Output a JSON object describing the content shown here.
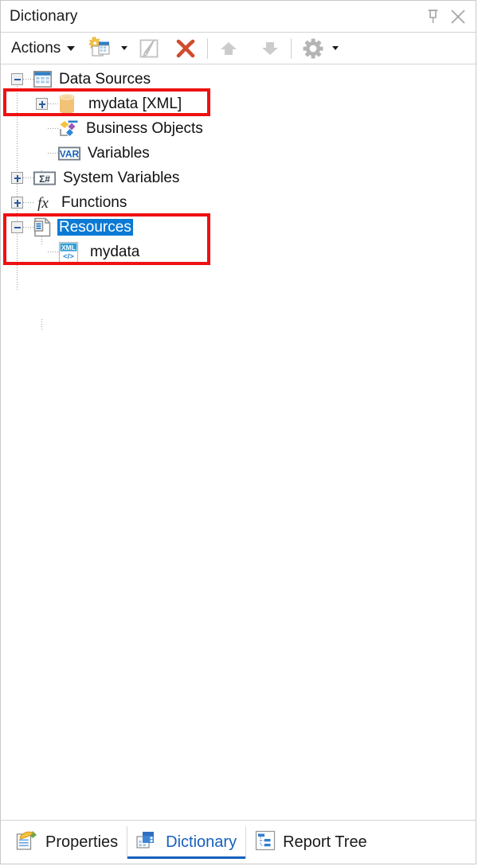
{
  "window": {
    "title": "Dictionary",
    "pin_icon": "pin-icon",
    "close_icon": "close-icon"
  },
  "toolbar": {
    "actions_label": "Actions",
    "actions_caret": "chevron-down-icon",
    "new_item_icon": "new-data-source-icon",
    "new_item_caret": "chevron-down-icon",
    "edit_icon": "edit-pencil-icon",
    "delete_icon": "delete-x-icon",
    "move_up_icon": "arrow-up-icon",
    "move_down_icon": "arrow-down-icon",
    "settings_icon": "gear-icon",
    "settings_caret": "chevron-down-icon"
  },
  "tree": {
    "nodes": [
      {
        "label": "Data Sources",
        "icon": "table-grid-icon",
        "toggle": "minus",
        "level": 0,
        "selected": false
      },
      {
        "label": "mydata [XML]",
        "icon": "database-cylinder-icon",
        "toggle": "plus",
        "level": 1,
        "selected": false
      },
      {
        "label": "Business Objects",
        "icon": "business-objects-icon",
        "toggle": "none",
        "level": 0,
        "selected": false
      },
      {
        "label": "Variables",
        "icon": "var-icon",
        "toggle": "none",
        "level": 0,
        "selected": false
      },
      {
        "label": "System Variables",
        "icon": "sigma-hash-icon",
        "toggle": "plus",
        "level": 0,
        "selected": false
      },
      {
        "label": "Functions",
        "icon": "fx-icon",
        "toggle": "plus",
        "level": 0,
        "selected": false
      },
      {
        "label": "Resources",
        "icon": "resources-page-icon",
        "toggle": "minus",
        "level": 0,
        "selected": true
      },
      {
        "label": "mydata",
        "icon": "xml-file-icon",
        "toggle": "none",
        "level": 1,
        "selected": false
      }
    ]
  },
  "annotations": {
    "highlight_color": "#ee1111",
    "boxes": [
      {
        "name": "highlight-mydata-datasource"
      },
      {
        "name": "highlight-resources-subtree"
      }
    ]
  },
  "bottom_tabs": [
    {
      "label": "Properties",
      "icon": "properties-icon",
      "active": false
    },
    {
      "label": "Dictionary",
      "icon": "dictionary-icon",
      "active": true
    },
    {
      "label": "Report Tree",
      "icon": "report-tree-icon",
      "active": false
    }
  ]
}
